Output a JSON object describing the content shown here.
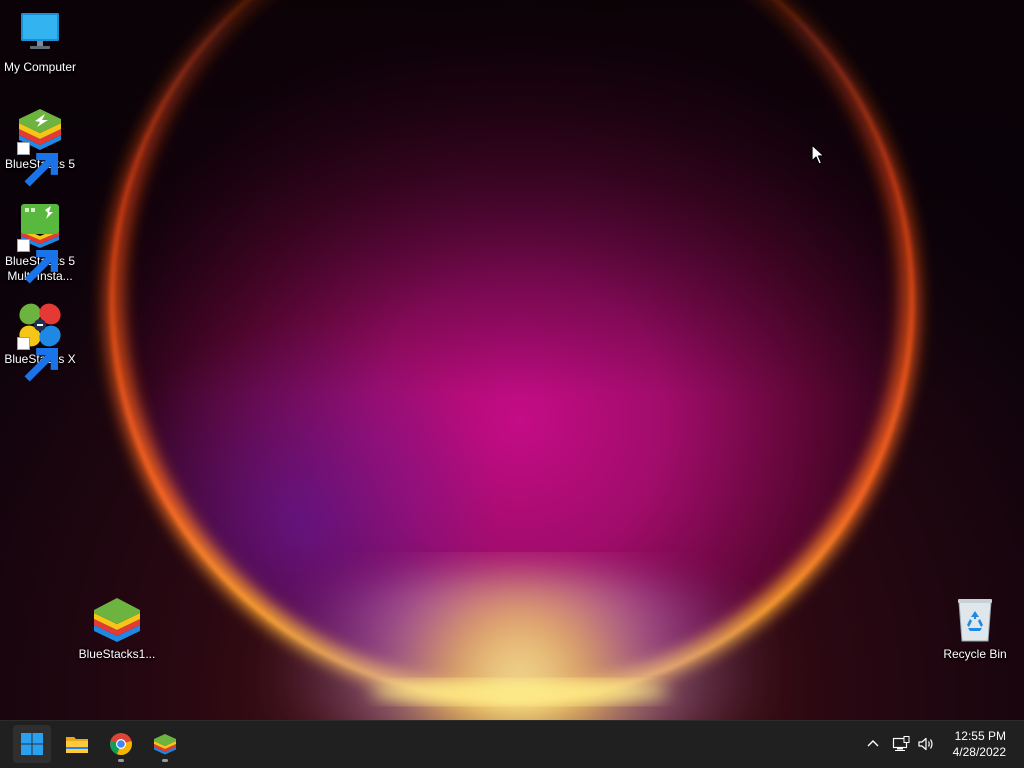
{
  "desktop": {
    "icons": [
      {
        "label": "My Computer",
        "icon": "monitor-icon"
      },
      {
        "label": "BlueStacks 5",
        "icon": "bluestacks-icon",
        "shortcut": true
      },
      {
        "label_line1": "BlueStacks 5",
        "label_line2": "Multi-Insta...",
        "icon": "bluestacks-multi-instance-icon",
        "shortcut": true
      },
      {
        "label": "BlueStacks X",
        "icon": "bluestacks-x-icon",
        "shortcut": true
      },
      {
        "label": "BlueStacks1...",
        "icon": "bluestacks-installer-icon"
      },
      {
        "label": "Recycle Bin",
        "icon": "recycle-bin-icon"
      }
    ]
  },
  "taskbar": {
    "pinned": [
      {
        "name": "start",
        "icon": "windows-logo-icon",
        "active": true
      },
      {
        "name": "file-explorer",
        "icon": "folder-icon"
      },
      {
        "name": "chrome",
        "icon": "chrome-icon",
        "running": true
      },
      {
        "name": "bluestacks",
        "icon": "bluestacks-icon",
        "running": true
      }
    ],
    "tray": {
      "icons": [
        "chevron-up-icon",
        "network-icon",
        "volume-icon"
      ],
      "time": "12:55 PM",
      "date": "4/28/2022"
    }
  },
  "colors": {
    "taskbar_bg": "#202020",
    "windows_blue": "#0078d4",
    "bluestacks_green": "#6db33f",
    "bluestacks_yellow": "#f5c518",
    "bluestacks_red": "#e53935",
    "bluestacks_blue": "#1e88e5"
  }
}
